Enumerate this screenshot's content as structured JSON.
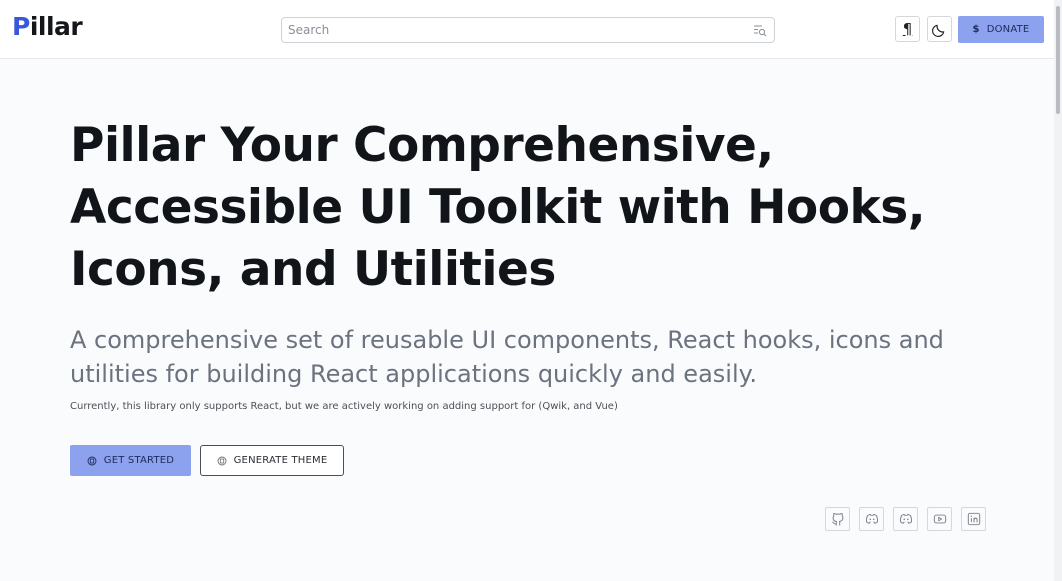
{
  "header": {
    "logo_first": "P",
    "logo_rest": "illar",
    "search_placeholder": "Search",
    "lang_glyph": "¶",
    "donate_symbol": "$",
    "donate_label": "DONATE"
  },
  "hero": {
    "title": "Pillar Your Comprehensive, Accessible UI Toolkit with Hooks, Icons, and Utilities",
    "subtitle": "A comprehensive set of reusable UI components, React hooks, icons and utilities for building React applications quickly and easily.",
    "note": "Currently, this library only supports React, but we are actively working on adding support for (Qwik, and Vue)",
    "primary_button": "GET STARTED",
    "secondary_button": "GENERATE THEME"
  },
  "social": [
    "github-icon",
    "discord-icon",
    "discord-icon",
    "youtube-icon",
    "linkedin-icon"
  ],
  "colors": {
    "accent": "#8da2ee",
    "logo_accent": "#3b57d9",
    "text": "#111418",
    "muted": "#6b7280"
  }
}
